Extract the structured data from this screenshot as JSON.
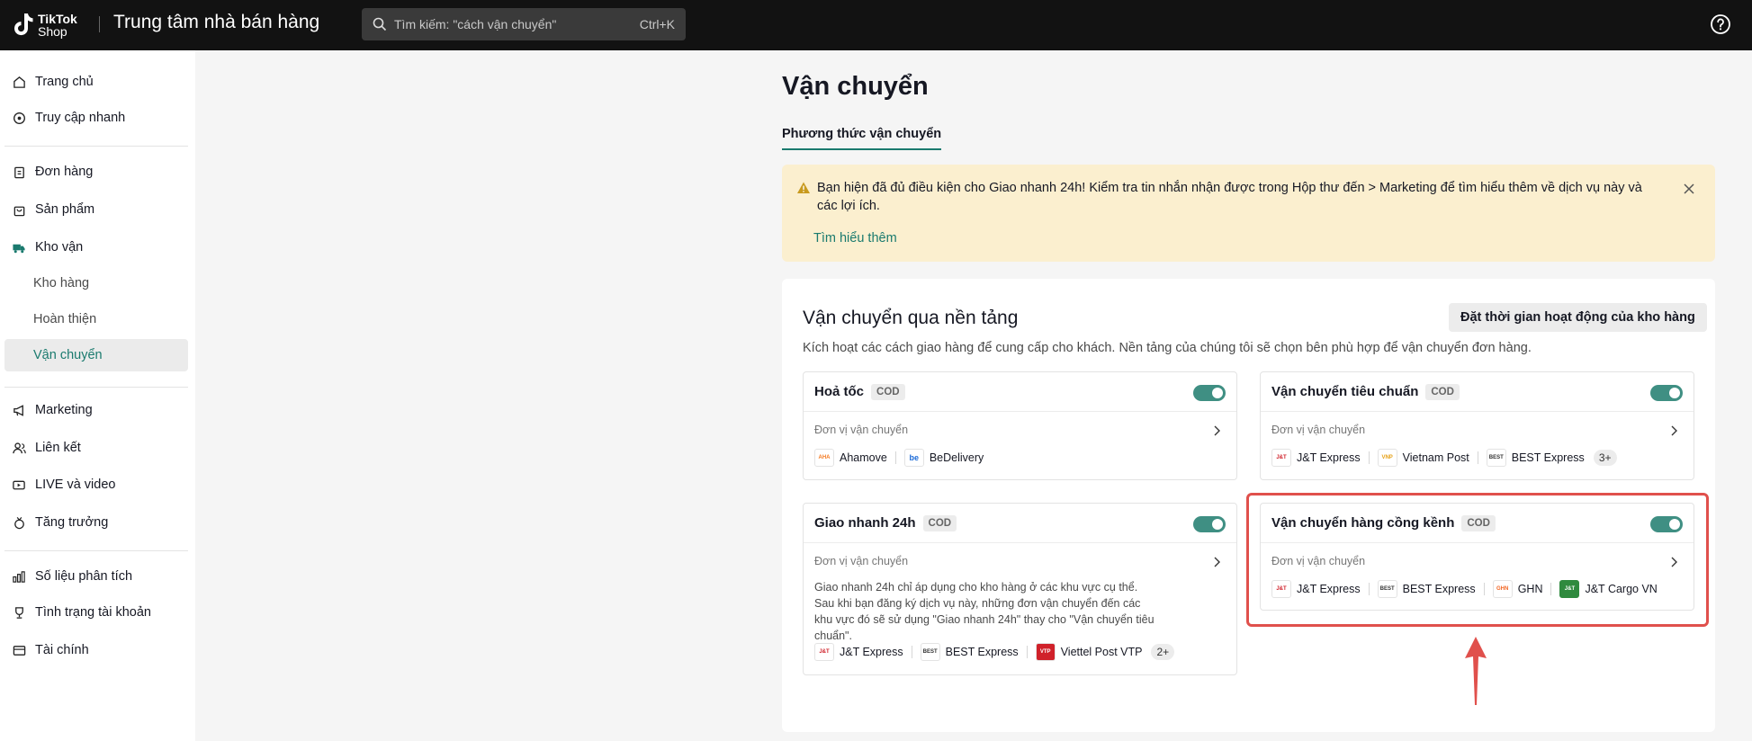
{
  "app": {
    "logo_line1": "TikTok",
    "logo_line2": "Shop",
    "title": "Trung tâm nhà bán hàng"
  },
  "search": {
    "placeholder": "Tìm kiếm: \"cách vận chuyển\"",
    "shortcut": "Ctrl+K"
  },
  "sidebar": {
    "items": [
      {
        "label": "Trang chủ",
        "icon": "home-icon"
      },
      {
        "label": "Truy cập nhanh",
        "icon": "quick-access-icon"
      },
      {
        "label": "Đơn hàng",
        "icon": "clipboard-icon"
      },
      {
        "label": "Sản phẩm",
        "icon": "bag-icon"
      },
      {
        "label": "Kho vận",
        "icon": "truck-icon"
      },
      {
        "label": "Kho hàng"
      },
      {
        "label": "Hoàn thiện"
      },
      {
        "label": "Vận chuyển"
      },
      {
        "label": "Marketing",
        "icon": "megaphone-icon"
      },
      {
        "label": "Liên kết",
        "icon": "people-icon"
      },
      {
        "label": "LIVE và video",
        "icon": "video-icon"
      },
      {
        "label": "Tăng trưởng",
        "icon": "medal-icon"
      },
      {
        "label": "Số liệu phân tích",
        "icon": "chart-icon"
      },
      {
        "label": "Tình trạng tài khoản",
        "icon": "trophy-icon"
      },
      {
        "label": "Tài chính",
        "icon": "wallet-icon"
      }
    ]
  },
  "page": {
    "title": "Vận chuyển",
    "tab": "Phương thức vận chuyển"
  },
  "banner": {
    "text": "Bạn hiện đã đủ điều kiện cho Giao nhanh 24h! Kiểm tra tin nhắn nhận được trong Hộp thư đến > Marketing để tìm hiểu thêm về dịch vụ này và các lợi ích.",
    "link": "Tìm hiểu thêm"
  },
  "panel": {
    "title": "Vận chuyển qua nền tảng",
    "description": "Kích hoạt các cách giao hàng để cung cấp cho khách. Nền tảng của chúng tôi sẽ chọn bên phù hợp để vận chuyển đơn hàng.",
    "button": "Đặt thời gian hoạt động của kho hàng"
  },
  "cards": {
    "hoatoc": {
      "title": "Hoả tốc",
      "badge": "COD",
      "carrier_label": "Đơn vị vận chuyển",
      "carriers": [
        "Ahamove",
        "BeDelivery"
      ]
    },
    "tieuchuan": {
      "title": "Vận chuyển tiêu chuẩn",
      "badge": "COD",
      "carrier_label": "Đơn vị vận chuyển",
      "carriers": [
        "J&T Express",
        "Vietnam Post",
        "BEST Express"
      ],
      "more": "3+"
    },
    "giaonhanh": {
      "title": "Giao nhanh 24h",
      "badge": "COD",
      "carrier_label": "Đơn vị vận chuyển",
      "note": "Giao nhanh 24h chỉ áp dụng cho kho hàng ở các khu vực cụ thể. Sau khi bạn đăng ký dịch vụ này, những đơn vận chuyển đến các khu vực đó sẽ sử dụng \"Giao nhanh 24h\" thay cho \"Vận chuyển tiêu chuẩn\".",
      "carriers": [
        "J&T Express",
        "BEST Express",
        "Viettel Post VTP"
      ],
      "more": "2+"
    },
    "congkenh": {
      "title": "Vận chuyển hàng cồng kềnh",
      "badge": "COD",
      "carrier_label": "Đơn vị vận chuyển",
      "carriers": [
        "J&T Express",
        "BEST Express",
        "GHN",
        "J&T Cargo VN"
      ]
    }
  },
  "colors": {
    "accent": "#1a7a6e",
    "toggle_on": "#3f8f83",
    "banner_bg": "#fbefcf",
    "highlight": "#e0504c"
  }
}
